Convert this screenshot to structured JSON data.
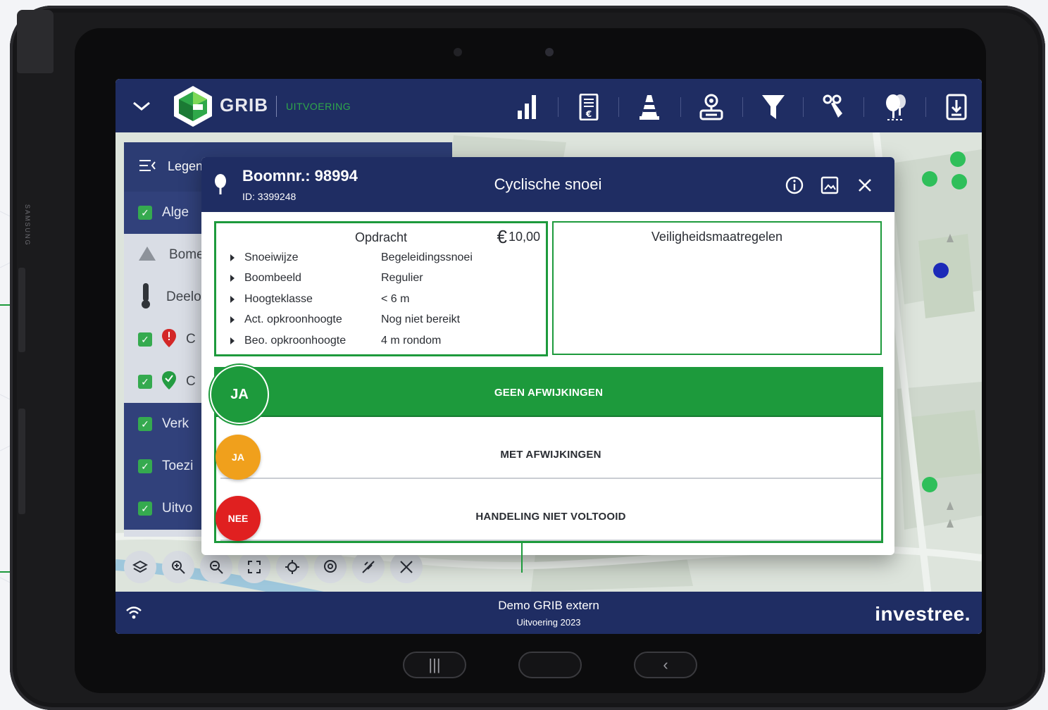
{
  "app": {
    "logo_text": "GRIB",
    "logo_sub": "UITVOERING"
  },
  "legend": {
    "title": "Legen",
    "rows": [
      {
        "label": "Alge",
        "checked": true
      },
      {
        "label": "Bome",
        "icon": "warning-triangle-icon"
      },
      {
        "label": "Deelo",
        "icon": "tree-pin-icon"
      },
      {
        "label": "C",
        "checked": true,
        "icon": "red-marker-icon"
      },
      {
        "label": "C",
        "checked": true,
        "icon": "green-marker-icon"
      },
      {
        "label": "Verk",
        "checked": true
      },
      {
        "label": "Toezi",
        "checked": true
      },
      {
        "label": "Uitvo",
        "checked": true
      }
    ]
  },
  "modal": {
    "tree_number": "Boomnr.: 98994",
    "tree_id": "ID: 3399248",
    "title": "Cyclische snoei",
    "assignment": {
      "title": "Opdracht",
      "currency": "€",
      "price": "10,00",
      "properties": [
        {
          "key": "Snoeiwijze",
          "value": "Begeleidingssnoei"
        },
        {
          "key": "Boombeeld",
          "value": "Regulier"
        },
        {
          "key": "Hoogteklasse",
          "value": "< 6 m"
        },
        {
          "key": "Act. opkroonhoogte",
          "value": "Nog niet bereikt"
        },
        {
          "key": "Beo. opkroonhoogte",
          "value": "4 m rondom"
        }
      ]
    },
    "safety": {
      "title": "Veiligheidsmaatregelen"
    },
    "choices": [
      {
        "badge": "JA",
        "label": "GEEN AFWIJKINGEN",
        "badge_color": "#1d9a3c",
        "selected": true
      },
      {
        "badge": "JA",
        "label": "MET AFWIJKINGEN",
        "badge_color": "#f0a01c",
        "selected": false
      },
      {
        "badge": "NEE",
        "label": "HANDELING NIET VOLTOOID",
        "badge_color": "#e02020",
        "selected": false
      }
    ]
  },
  "footer": {
    "env_title": "Demo GRIB extern",
    "env_sub": "Uitvoering 2023",
    "brand": "investree."
  },
  "device": {
    "brand": "SAMSUNG"
  },
  "colors": {
    "navy": "#1f2d63",
    "green": "#1d9a3c",
    "orange": "#f0a01c",
    "red": "#e02020"
  }
}
